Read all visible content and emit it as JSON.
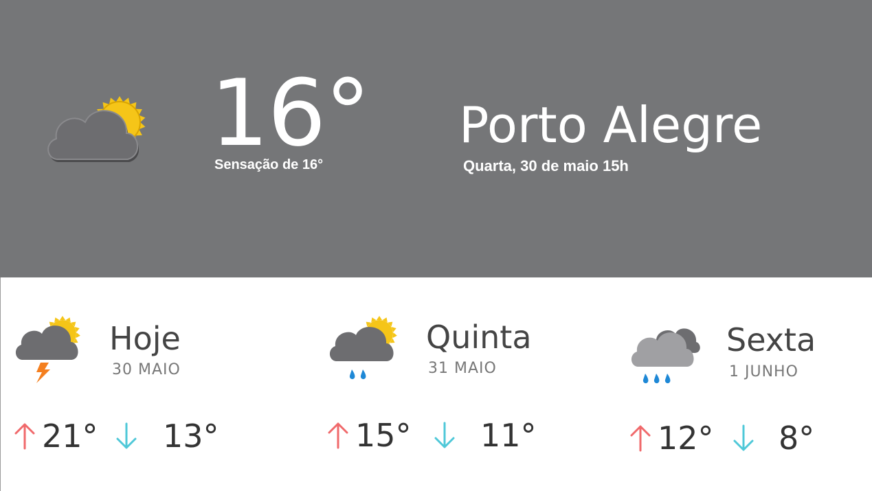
{
  "current": {
    "icon": "partly-cloudy-icon",
    "temperature": "16°",
    "feels_like": "Sensação de 16°",
    "city": "Porto Alegre",
    "datetime": "Quarta, 30 de maio 15h"
  },
  "forecast": [
    {
      "name": "Hoje",
      "date": "30 MAIO",
      "icon": "partly-cloudy-thunder-icon",
      "max": "21°",
      "min": "13°"
    },
    {
      "name": "Quinta",
      "date": "31 MAIO",
      "icon": "partly-cloudy-rain-icon",
      "max": "15°",
      "min": "11°"
    },
    {
      "name": "Sexta",
      "date": "1 JUNHO",
      "icon": "cloudy-rain-icon",
      "max": "12°",
      "min": "8°"
    }
  ],
  "colors": {
    "header_bg": "#757678",
    "max_arrow": "#f0696b",
    "min_arrow": "#4fc8d8",
    "sun": "#f5c518",
    "cloud": "#6d6d70",
    "rain": "#1e88d6",
    "lightning": "#f47f1f"
  }
}
